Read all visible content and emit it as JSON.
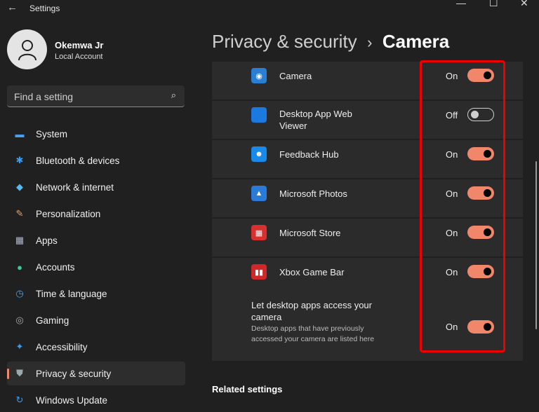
{
  "window": {
    "title": "Settings",
    "back": "←",
    "minimize": "—",
    "maximize": "☐",
    "close": "✕"
  },
  "user": {
    "name": "Okemwa Jr",
    "account_type": "Local Account"
  },
  "search": {
    "placeholder": "Find a setting",
    "icon": "⌕"
  },
  "nav": [
    {
      "label": "System",
      "icon": "▬",
      "color": "#4aa0f0"
    },
    {
      "label": "Bluetooth & devices",
      "icon": "✱",
      "color": "#3a9df5"
    },
    {
      "label": "Network & internet",
      "icon": "◆",
      "color": "#5ab8f0"
    },
    {
      "label": "Personalization",
      "icon": "✎",
      "color": "#f0a060"
    },
    {
      "label": "Apps",
      "icon": "▦",
      "color": "#b0b8c8"
    },
    {
      "label": "Accounts",
      "icon": "●",
      "color": "#40c8a0"
    },
    {
      "label": "Time & language",
      "icon": "◷",
      "color": "#4aa0f0"
    },
    {
      "label": "Gaming",
      "icon": "◎",
      "color": "#aaa"
    },
    {
      "label": "Accessibility",
      "icon": "✦",
      "color": "#3a9df5"
    },
    {
      "label": "Privacy & security",
      "icon": "⛊",
      "color": "#9aa"
    },
    {
      "label": "Windows Update",
      "icon": "↻",
      "color": "#3a9df5"
    }
  ],
  "breadcrumb": {
    "parent": "Privacy & security",
    "separator": "›",
    "current": "Camera"
  },
  "apps": [
    {
      "name": "Camera",
      "state": "On",
      "on": true,
      "icon_color": "#2a7fd4",
      "glyph": "◉"
    },
    {
      "name": "Desktop App Web\nViewer",
      "state": "Off",
      "on": false,
      "icon_color": "#1a7ae0",
      "glyph": ""
    },
    {
      "name": "Feedback Hub",
      "state": "On",
      "on": true,
      "icon_color": "#1a8ae8",
      "glyph": "☻"
    },
    {
      "name": "Microsoft Photos",
      "state": "On",
      "on": true,
      "icon_color": "#2a7ad8",
      "glyph": "▲"
    },
    {
      "name": "Microsoft Store",
      "state": "On",
      "on": true,
      "icon_color": "#d83030",
      "glyph": "▦"
    },
    {
      "name": "Xbox Game Bar",
      "state": "On",
      "on": true,
      "icon_color": "#d02828",
      "glyph": "▮▮"
    }
  ],
  "desktop_apps": {
    "title": "Let desktop apps access your camera",
    "description": "Desktop apps that have previously accessed your camera are listed here",
    "state": "On"
  },
  "related_settings": "Related settings"
}
